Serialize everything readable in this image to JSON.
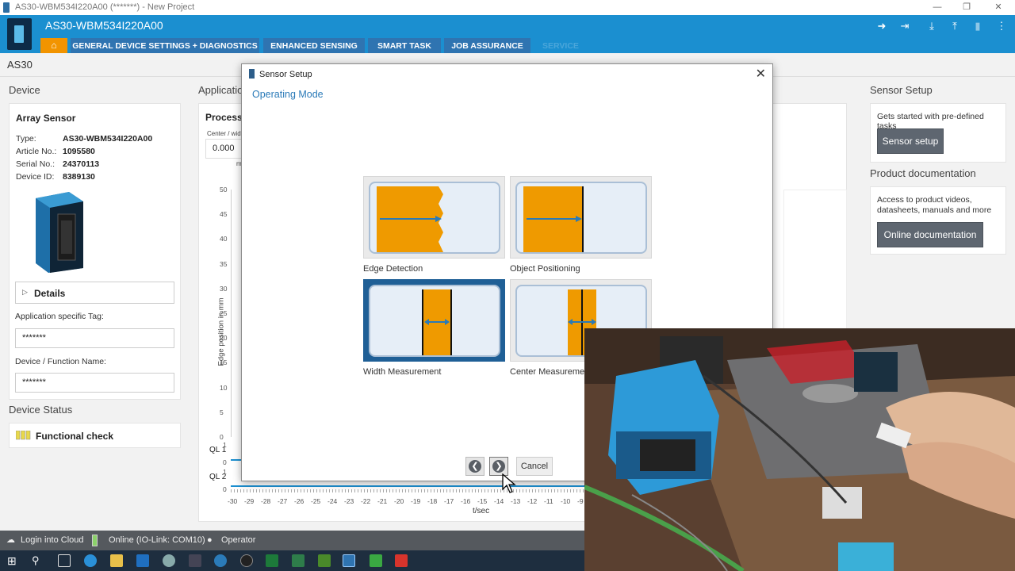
{
  "window": {
    "title": "AS30-WBM534I220A00 (*******) - New Project"
  },
  "header": {
    "device_name": "AS30-WBM534I220A00",
    "tabs": [
      {
        "label": "GENERAL DEVICE SETTINGS + DIAGNOSTICS"
      },
      {
        "label": "ENHANCED SENSING"
      },
      {
        "label": "SMART TASK"
      },
      {
        "label": "JOB ASSURANCE"
      },
      {
        "label": "SERVICE"
      }
    ]
  },
  "breadcrumb": "AS30",
  "device": {
    "section_title": "Device",
    "card_title": "Array Sensor",
    "fields": [
      {
        "label": "Type:",
        "value": "AS30-WBM534I220A00"
      },
      {
        "label": "Article No.:",
        "value": "1095580"
      },
      {
        "label": "Serial No.:",
        "value": "24370113"
      },
      {
        "label": "Device ID:",
        "value": "8389130"
      }
    ],
    "details_label": "Details",
    "app_tag_label": "Application specific Tag:",
    "app_tag_value": "*******",
    "func_name_label": "Device / Function Name:",
    "func_name_value": "*******"
  },
  "device_status": {
    "section_title": "Device Status",
    "label": "Functional check"
  },
  "application": {
    "section_title": "Applicatio",
    "process_title": "Process",
    "center_label": "Center / wid",
    "value": "0.000",
    "unit": "m",
    "y_axis_label": "Edge position in mm",
    "y_ticks": [
      "50",
      "45",
      "40",
      "35",
      "30",
      "25",
      "20",
      "15",
      "10",
      "5",
      "0"
    ],
    "ql1": "QL 1",
    "ql2": "QL 2",
    "ql_ticks": [
      "1",
      "0",
      "1",
      "0"
    ],
    "x_ticks": [
      "-30",
      "-29",
      "-28",
      "-27",
      "-26",
      "-25",
      "-24",
      "-23",
      "-22",
      "-21",
      "-20",
      "-19",
      "-18",
      "-17",
      "-16",
      "-15",
      "-14",
      "-13",
      "-12",
      "-11",
      "-10",
      "-9"
    ],
    "x_label": "t/sec"
  },
  "sensor_setup": {
    "section_title": "Sensor Setup",
    "description": "Gets started with pre-defined tasks",
    "button": "Sensor setup"
  },
  "product_doc": {
    "section_title": "Product documentation",
    "description": "Access to product videos, datasheets, manuals and more",
    "button": "Online documentation"
  },
  "dialog": {
    "title": "Sensor Setup",
    "subtitle": "Operating Mode",
    "modes": [
      {
        "label": "Edge Detection"
      },
      {
        "label": "Object Positioning"
      },
      {
        "label": "Width Measurement",
        "selected": true
      },
      {
        "label": "Center Measurement"
      }
    ],
    "cancel": "Cancel"
  },
  "footer": {
    "cloud": "Login into Cloud",
    "status": "Online (IO-Link: COM10)",
    "role": "Operator"
  },
  "colors": {
    "header": "#1b8fd0",
    "tab": "#2f74b1",
    "home": "#f29400",
    "accent_orange": "#ef9a00",
    "selected": "#1f5f96"
  }
}
